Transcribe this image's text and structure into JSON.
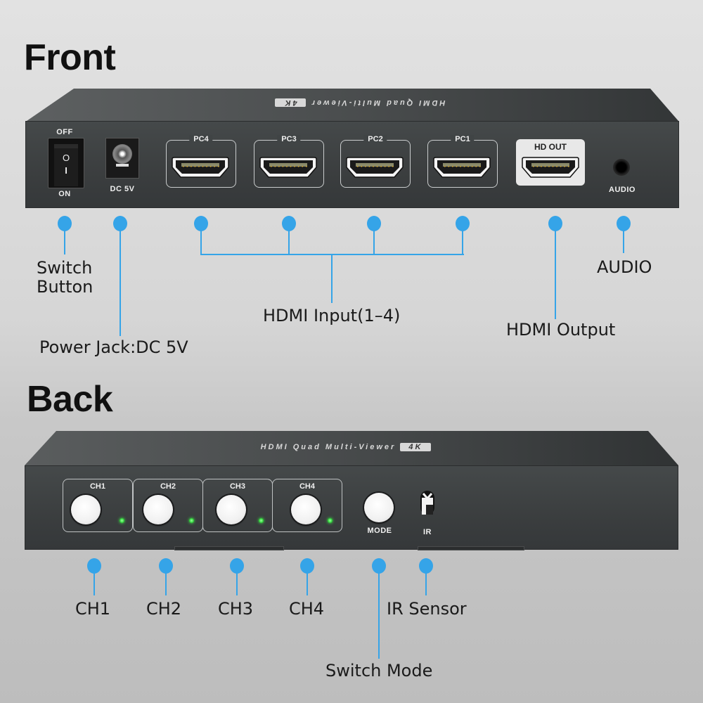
{
  "sections": {
    "front_title": "Front",
    "back_title": "Back"
  },
  "device": {
    "top_print": "HDMI Quad Multi-Viewer",
    "top_badge": "4K"
  },
  "front_panel": {
    "switch": {
      "off_label": "OFF",
      "on_label": "ON",
      "symbol_off": "O",
      "symbol_on": "I"
    },
    "dc_label": "DC 5V",
    "inputs": [
      {
        "label": "PC4"
      },
      {
        "label": "PC3"
      },
      {
        "label": "PC2"
      },
      {
        "label": "PC1"
      }
    ],
    "output_label": "HD OUT",
    "audio_label": "AUDIO"
  },
  "front_callouts": {
    "switch_button": [
      "Switch",
      "Button"
    ],
    "power_jack": "Power Jack:DC 5V",
    "hdmi_input": "HDMI Input(1–4)",
    "hdmi_output": "HDMI Output",
    "audio": "AUDIO"
  },
  "back_panel": {
    "channels": [
      {
        "label": "CH1",
        "led": "on"
      },
      {
        "label": "CH2",
        "led": "on"
      },
      {
        "label": "CH3",
        "led": "on"
      },
      {
        "label": "CH4",
        "led": "on"
      }
    ],
    "mode_label": "MODE",
    "ir_label": "IR"
  },
  "back_callouts": {
    "ch1": "CH1",
    "ch2": "CH2",
    "ch3": "CH3",
    "ch4": "CH4",
    "ir_sensor": "IR Sensor",
    "switch_mode": "Switch Mode"
  },
  "colors": {
    "accent_blue": "#35a4e8",
    "device_body": "#3d4142",
    "led_green": "#2fd43a"
  }
}
